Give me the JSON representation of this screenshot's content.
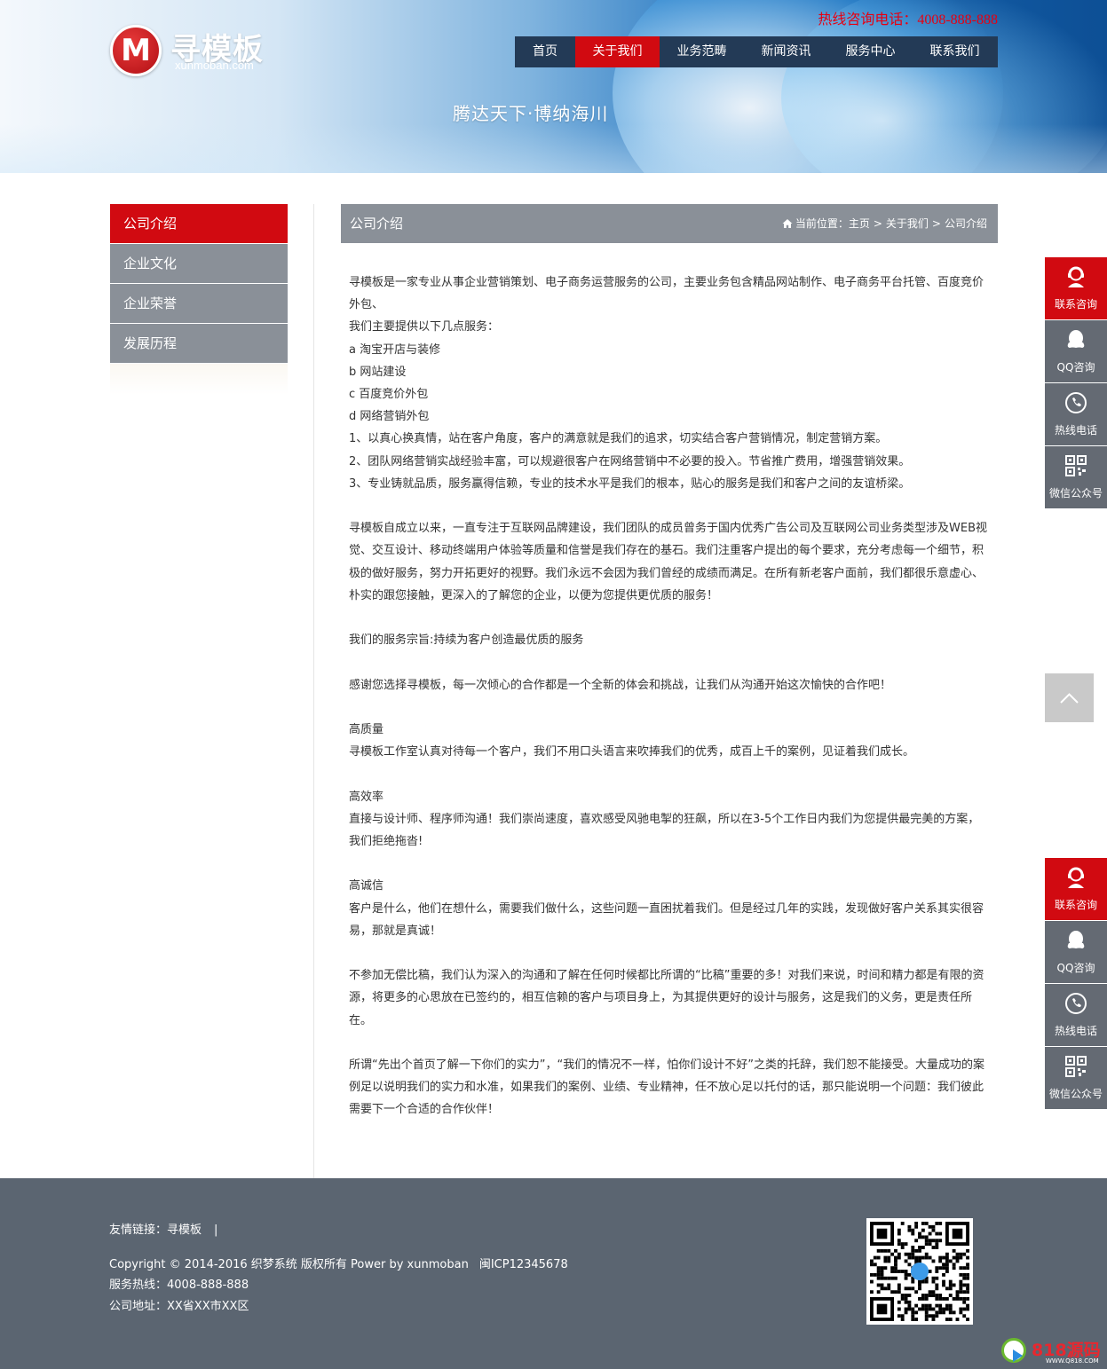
{
  "header": {
    "logo_mark": "M",
    "logo_name": "寻模板",
    "logo_domain": "xunmoban.com",
    "hotline": "热线咨询电话：4008-888-888",
    "slogan": "腾达天下·博纳海川"
  },
  "nav": {
    "items": [
      "首页",
      "关于我们",
      "业务范畴",
      "新闻资讯",
      "服务中心",
      "联系我们"
    ],
    "active": "关于我们"
  },
  "sidebar": {
    "items": [
      "公司介绍",
      "企业文化",
      "企业荣誉",
      "发展历程"
    ],
    "active": "公司介绍"
  },
  "content": {
    "title": "公司介绍",
    "breadcrumb": {
      "icon": "home-icon",
      "prefix": "当前位置：",
      "items": [
        "主页",
        "关于我们",
        "公司介绍"
      ],
      "separator": ">"
    },
    "paragraphs": [
      "寻模板是一家专业从事企业营销策划、电子商务运营服务的公司，主要业务包含精品网站制作、电子商务平台托管、百度竞价外包、",
      "我们主要提供以下几点服务：",
      "a  淘宝开店与装修",
      "b  网站建设",
      "c  百度竞价外包",
      "d  网络营销外包",
      "1、以真心换真情，站在客户角度，客户的满意就是我们的追求，切实结合客户营销情况，制定营销方案。",
      "2、团队网络营销实战经验丰富，可以规避很客户在网络营销中不必要的投入。节省推广费用，增强营销效果。",
      "3、专业铸就品质，服务赢得信赖，专业的技术水平是我们的根本，贴心的服务是我们和客户之间的友谊桥梁。",
      "",
      "寻模板自成立以来，一直专注于互联网品牌建设，我们团队的成员曾务于国内优秀广告公司及互联网公司业务类型涉及WEB视觉、交互设计、移动终端用户体验等质量和信誉是我们存在的基石。我们注重客户提出的每个要求，充分考虑每一个细节，积极的做好服务，努力开拓更好的视野。我们永远不会因为我们曾经的成绩而满足。在所有新老客户面前，我们都很乐意虚心、朴实的跟您接触，更深入的了解您的企业，以便为您提供更优质的服务！",
      "",
      "我们的服务宗旨:持续为客户创造最优质的服务",
      "",
      "感谢您选择寻模板，每一次倾心的合作都是一个全新的体会和挑战，让我们从沟通开始这次愉快的合作吧！",
      "",
      "高质量",
      "寻模板工作室认真对待每一个客户，我们不用口头语言来吹捧我们的优秀，成百上千的案例，见证着我们成长。",
      "",
      "高效率",
      "直接与设计师、程序师沟通！我们崇尚速度，喜欢感受风驰电掣的狂飙，所以在3-5个工作日内我们为您提供最完美的方案，我们拒绝拖沓!",
      "",
      "高诚信",
      "客户是什么，他们在想什么，需要我们做什么，这些问题一直困扰着我们。但是经过几年的实践，发现做好客户关系其实很容易，那就是真诚！",
      "",
      "不参加无偿比稿，我们认为深入的沟通和了解在任何时候都比所谓的“比稿”重要的多！对我们来说，时间和精力都是有限的资源，将更多的心思放在已签约的，相互信赖的客户与项目身上，为其提供更好的设计与服务，这是我们的义务，更是责任所在。",
      "",
      "所谓“先出个首页了解一下你们的实力”，“我们的情况不一样，怕你们设计不好”之类的托辞，我们恕不能接受。大量成功的案例足以说明我们的实力和水准，如果我们的案例、业绩、专业精神，任不放心足以托付的话，那只能说明一个问题：我们彼此需要下一个合适的合作伙伴！"
    ]
  },
  "float_bar": {
    "items": [
      {
        "label": "联系咨询",
        "icon": "customer-service-icon"
      },
      {
        "label": "QQ咨询",
        "icon": "qq-icon"
      },
      {
        "label": "热线电话",
        "icon": "phone-icon"
      },
      {
        "label": "微信公众号",
        "icon": "qr-code-icon"
      }
    ],
    "to_top_icon": "chevron-up-icon"
  },
  "footer": {
    "friend_links_label": "友情链接：",
    "friend_links": [
      "寻模板"
    ],
    "friend_links_sep": "|",
    "copyright": "Copyright © 2014-2016 织梦系统 版权所有 Power by xunmoban",
    "icp": "闽ICP12345678",
    "hotline": "服务热线：4008-888-888",
    "address": "公司地址：XX省XX市XX区",
    "qr_icon": "wechat-qr-code"
  },
  "watermark": {
    "text": "818源码",
    "sub": "WWW.Q818.COM"
  },
  "colors": {
    "accent_red": "#d10a11",
    "nav_bg": "#233a56",
    "sidebar_gray": "#8a9098",
    "float_gray": "#646a73",
    "footer_bg": "#5b6571"
  }
}
